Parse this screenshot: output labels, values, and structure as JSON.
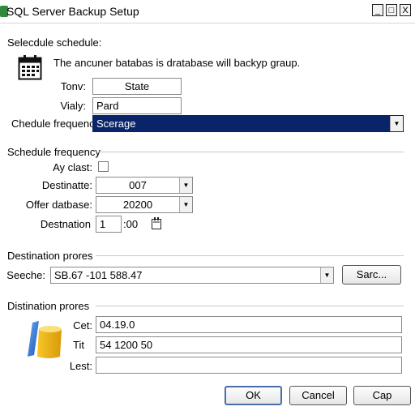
{
  "window": {
    "title": "SQL Server Backup Setup",
    "min": "_",
    "max": "□",
    "close": "X"
  },
  "schedule": {
    "heading": "Selecdule schedule:",
    "description": "The ancuner batabas is dratabase will backyp graup.",
    "tony_label": "Tonv:",
    "tony_value": "State",
    "vialy_label": "Vialy:",
    "vialy_value": "Pard",
    "freq_label": "Chedule frequency",
    "freq_value": "Scerage"
  },
  "frequency": {
    "heading": "Schedule frequency",
    "ayclast_label": "Ay clast:",
    "destinate_label": "Destinatte:",
    "destinate_value": "007",
    "offer_label": "Offer datbase:",
    "offer_value": "20200",
    "destnation_label": "Destnation",
    "hour_value": "1",
    "minute_value": ":00"
  },
  "destination1": {
    "heading": "Destination prores",
    "seeche_label": "Seeche:",
    "seeche_value": "SB.67 -101 588.47",
    "browse_label": "Sarc..."
  },
  "destination2": {
    "heading": "Distination prores",
    "cet_label": "Cet:",
    "cet_value": "04.19.0",
    "tit_label": "Tit",
    "tit_value": "54 1200 50",
    "lest_label": "Lest:",
    "lest_value": ""
  },
  "buttons": {
    "ok": "OK",
    "cancel": "Cancel",
    "cap": "Cap"
  },
  "colors": {
    "selection_bg": "#0a246a",
    "selection_fg": "#ffffff"
  }
}
